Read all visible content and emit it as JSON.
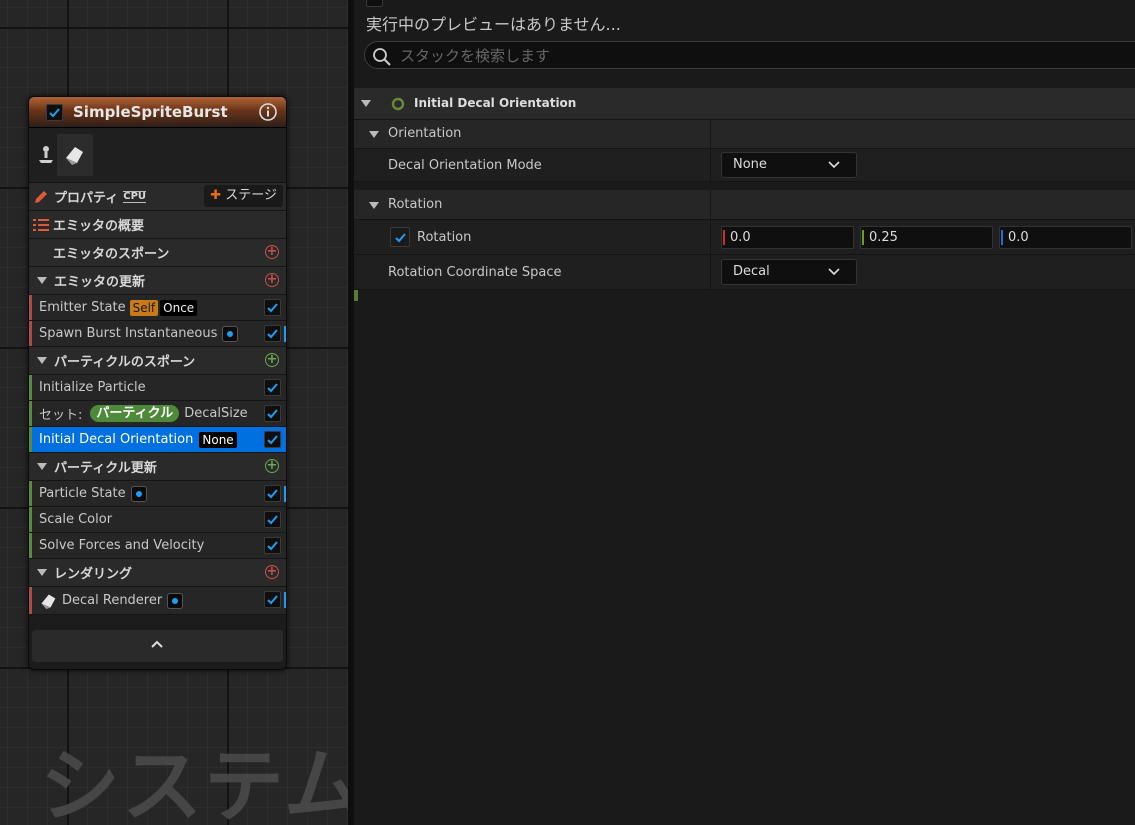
{
  "graph": {
    "watermark": "システム",
    "node": {
      "title": "SimpleSpriteBurst",
      "enabled": true,
      "toolbar": {
        "properties_label": "プロパティ",
        "sim_target": "CPU",
        "stage_button": "ステージ"
      },
      "sections": [
        {
          "label": "エミッタの概要",
          "plus": false
        },
        {
          "label": "エミッタのスポーン",
          "plus": true,
          "plus_color": "#c8504a"
        },
        {
          "label": "エミッタの更新",
          "plus": true,
          "plus_color": "#c8504a",
          "items": [
            {
              "label": "Emitter State",
              "tags": [
                "Self",
                "Once"
              ]
            },
            {
              "label": "Spawn Burst Instantaneous"
            }
          ]
        },
        {
          "label": "パーティクルのスポーン",
          "plus": true,
          "plus_color": "#6aa84f",
          "items": [
            {
              "label": "Initialize Particle"
            },
            {
              "prefix": "セット:",
              "pill": "パーティクル",
              "label": "DecalSize"
            },
            {
              "label": "Initial Decal Orientation",
              "tag": "None",
              "selected": true
            }
          ]
        },
        {
          "label": "パーティクル更新",
          "plus": true,
          "plus_color": "#6aa84f",
          "items": [
            {
              "label": "Particle State"
            },
            {
              "label": "Scale Color"
            },
            {
              "label": "Solve Forces and Velocity"
            }
          ]
        },
        {
          "label": "レンダリング",
          "plus": true,
          "plus_color": "#c8504a",
          "items": [
            {
              "label": "Decal Renderer"
            }
          ]
        }
      ]
    }
  },
  "panel": {
    "preview_text": "実行中のプレビューはありません...",
    "search": {
      "placeholder": "スタックを検索します",
      "value": ""
    },
    "module": {
      "title": "Initial Decal Orientation",
      "groups": [
        {
          "label": "Orientation",
          "props": [
            {
              "label": "Decal Orientation Mode",
              "value": "None"
            }
          ]
        },
        {
          "label": "Rotation",
          "props": [
            {
              "label": "Rotation",
              "enabled": true,
              "x": "0.0",
              "y": "0.25",
              "z": "0.0"
            },
            {
              "label": "Rotation Coordinate Space",
              "value": "Decal"
            }
          ]
        }
      ]
    }
  },
  "colors": {
    "selection": "#0070e0",
    "check": "#1e9ef0",
    "emitter_header": "#b26436"
  }
}
